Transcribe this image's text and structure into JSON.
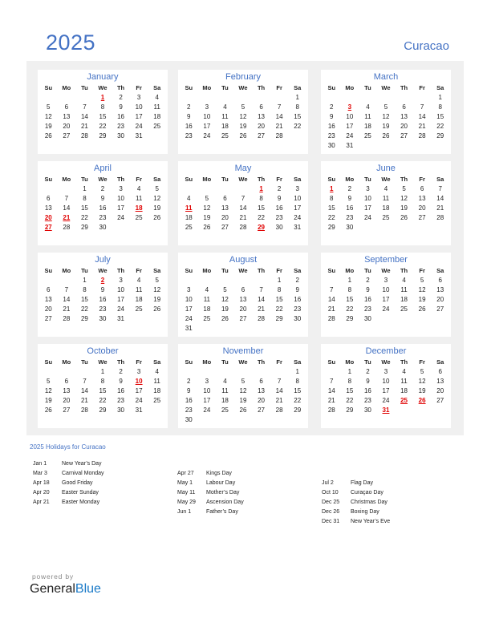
{
  "header": {
    "year": "2025",
    "country": "Curacao"
  },
  "weekdays": [
    "Su",
    "Mo",
    "Tu",
    "We",
    "Th",
    "Fr",
    "Sa"
  ],
  "months": [
    {
      "name": "January",
      "start": 3,
      "days": 31,
      "holidays": [
        1
      ]
    },
    {
      "name": "February",
      "start": 6,
      "days": 28,
      "holidays": []
    },
    {
      "name": "March",
      "start": 6,
      "days": 31,
      "holidays": [
        3
      ]
    },
    {
      "name": "April",
      "start": 2,
      "days": 30,
      "holidays": [
        18,
        20,
        21,
        27
      ]
    },
    {
      "name": "May",
      "start": 4,
      "days": 31,
      "holidays": [
        1,
        11,
        29
      ]
    },
    {
      "name": "June",
      "start": 0,
      "days": 30,
      "holidays": [
        1
      ]
    },
    {
      "name": "July",
      "start": 2,
      "days": 31,
      "holidays": [
        2
      ]
    },
    {
      "name": "August",
      "start": 5,
      "days": 31,
      "holidays": []
    },
    {
      "name": "September",
      "start": 1,
      "days": 30,
      "holidays": []
    },
    {
      "name": "October",
      "start": 3,
      "days": 31,
      "holidays": [
        10
      ]
    },
    {
      "name": "November",
      "start": 6,
      "days": 30,
      "holidays": []
    },
    {
      "name": "December",
      "start": 1,
      "days": 31,
      "holidays": [
        25,
        26,
        31
      ]
    }
  ],
  "holidays_title": "2025 Holidays for Curacao",
  "holiday_columns": [
    [
      {
        "date": "Jan 1",
        "name": "New Year’s Day"
      },
      {
        "date": "Mar 3",
        "name": "Carnival Monday"
      },
      {
        "date": "Apr 18",
        "name": "Good Friday"
      },
      {
        "date": "Apr 20",
        "name": "Easter Sunday"
      },
      {
        "date": "Apr 21",
        "name": "Easter Monday"
      }
    ],
    [
      {
        "date": "Apr 27",
        "name": "Kings Day"
      },
      {
        "date": "May 1",
        "name": "Labour Day"
      },
      {
        "date": "May 11",
        "name": "Mother’s Day"
      },
      {
        "date": "May 29",
        "name": "Ascension Day"
      },
      {
        "date": "Jun 1",
        "name": "Father’s Day"
      }
    ],
    [
      {
        "date": "Jul 2",
        "name": "Flag Day"
      },
      {
        "date": "Oct 10",
        "name": "Curaçao Day"
      },
      {
        "date": "Dec 25",
        "name": "Christmas Day"
      },
      {
        "date": "Dec 26",
        "name": "Boxing Day"
      },
      {
        "date": "Dec 31",
        "name": "New Year’s Eve"
      }
    ]
  ],
  "footer": {
    "powered_by": "powered by",
    "brand_general": "General",
    "brand_blue": "Blue"
  },
  "colors": {
    "accent": "#4472C4",
    "holiday": "#e00000",
    "panel": "#f0f0f0"
  }
}
